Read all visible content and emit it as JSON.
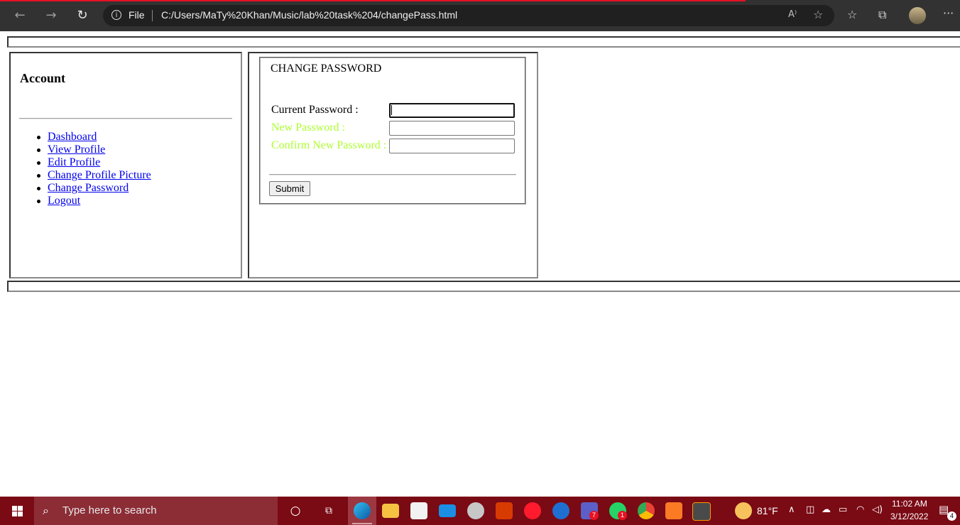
{
  "browser": {
    "back_icon": "←",
    "forward_icon": "→",
    "reload_icon": "↻",
    "info_icon": "i",
    "scheme_label": "File",
    "url": "C:/Users/MaTy%20Khan/Music/lab%20task%204/changePass.html",
    "read_aloud_icon": "A⁾",
    "favorite_add_icon": "☆",
    "favorites_icon": "☆",
    "collections_icon": "⧉",
    "more_icon": "···"
  },
  "sidebar": {
    "title": "Account",
    "links": [
      "Dashboard",
      "View Profile",
      "Edit Profile",
      "Change Profile Picture",
      "Change Password",
      "Logout"
    ]
  },
  "form": {
    "legend": "CHANGE PASSWORD",
    "current_label": "Current Password :",
    "new_label": "New Password :",
    "confirm_label": "Confirm New Password :",
    "current_value": "",
    "new_value": "",
    "confirm_value": "",
    "submit_label": "Submit",
    "label_color_secondary": "#adff2f"
  },
  "taskbar": {
    "search_placeholder": "Type here to search",
    "cortana_icon": "○",
    "task_view_icon": "⧉",
    "teams_badge": "7",
    "whatsapp_badge": "1",
    "weather_temp": "81°F",
    "time": "11:02 AM",
    "date": "3/12/2022",
    "notification_count": "4"
  }
}
